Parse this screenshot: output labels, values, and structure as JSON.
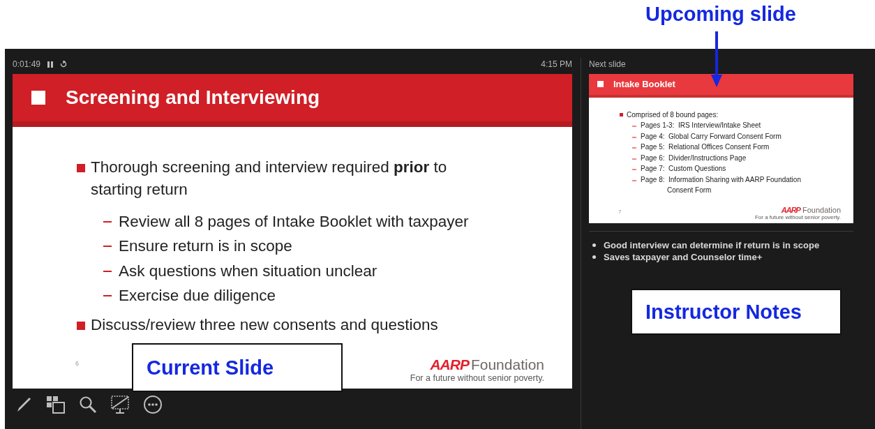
{
  "header": {
    "elapsed": "0:01:49",
    "clock": "4:15 PM"
  },
  "current_slide": {
    "title": "Screening and Interviewing",
    "bullets": [
      {
        "text": "Thorough screening and interview required **prior** to starting return",
        "children": [
          {
            "text": "Review all 8 pages of Intake Booklet with taxpayer"
          },
          {
            "text": "Ensure return is in scope"
          },
          {
            "text": "Ask questions when situation unclear"
          },
          {
            "text": "Exercise due diligence"
          }
        ]
      },
      {
        "text": "Discuss/review three new consents and questions"
      }
    ],
    "slide_number": "6",
    "logo": {
      "brand": "AARP",
      "name": "Foundation",
      "tagline": "For a future without senior poverty."
    }
  },
  "next_slide": {
    "label": "Next slide",
    "title": "Intake Booklet",
    "bullets": [
      {
        "text": "Comprised of 8 bound pages:",
        "children": [
          {
            "text": "Pages 1-3:  IRS Interview/Intake Sheet"
          },
          {
            "text": "Page 4:  Global Carry Forward Consent Form"
          },
          {
            "text": "Page 5:  Relational Offices Consent Form"
          },
          {
            "text": "Page 6:  Divider/Instructions Page"
          },
          {
            "text": "Page 7:  Custom Questions"
          },
          {
            "text": "Page 8:  Information Sharing with AARP Foundation Consent Form"
          }
        ]
      }
    ],
    "slide_number": "7",
    "logo": {
      "brand": "AARP",
      "name": "Foundation",
      "tagline": "For a future without senior poverty."
    }
  },
  "notes": [
    "Good interview can determine if return is in scope",
    "Saves taxpayer and Counselor time+"
  ],
  "annotations": [
    {
      "kind": "arrow",
      "text": "Upcoming slide"
    },
    {
      "kind": "box",
      "text": "Instructor Notes"
    },
    {
      "kind": "box",
      "text": "Current Slide"
    }
  ]
}
